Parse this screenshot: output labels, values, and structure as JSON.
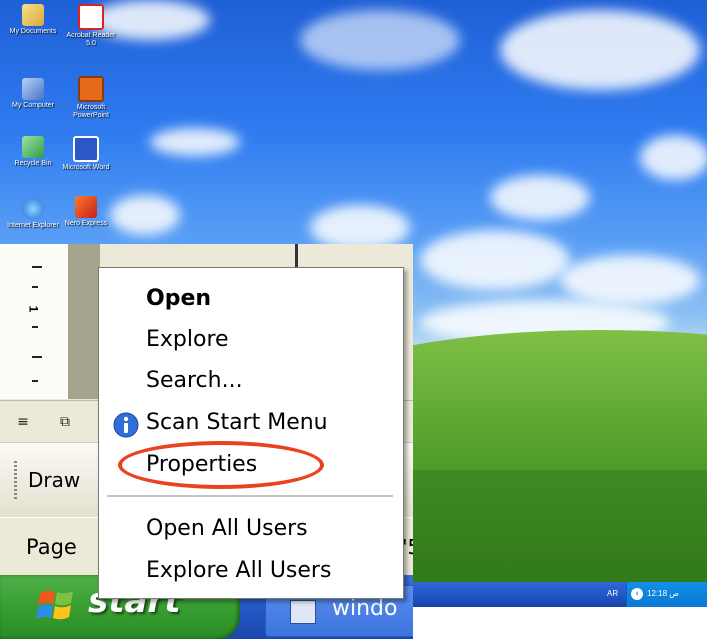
{
  "desktop": {
    "icons": [
      {
        "name": "my-documents-icon",
        "label": "My Documents"
      },
      {
        "name": "acrobat-reader-icon",
        "label": "Acrobat Reader 5.0"
      },
      {
        "name": "my-computer-icon",
        "label": "My Computer"
      },
      {
        "name": "powerpoint-icon",
        "label": "Microsoft PowerPoint"
      },
      {
        "name": "recycle-bin-icon",
        "label": "Recycle Bin"
      },
      {
        "name": "word-icon",
        "label": "Microsoft Word"
      },
      {
        "name": "internet-explorer-icon",
        "label": "Internet Explorer"
      },
      {
        "name": "nero-express-icon",
        "label": "Nero Express"
      }
    ],
    "tray": {
      "language": "AR",
      "clock": "12:18 ص"
    }
  },
  "word_window": {
    "ruler_number": "1",
    "draw_toolbar_label": "Draw",
    "status_page_label": "Page",
    "status_fragment": "'5"
  },
  "taskbar": {
    "start_label": "start",
    "task_label": "windo"
  },
  "context_menu": {
    "items": [
      {
        "label": "Open",
        "default": true
      },
      {
        "label": "Explore"
      },
      {
        "label": "Search..."
      },
      {
        "label": "Scan Start Menu"
      },
      {
        "label": "Properties"
      },
      {
        "label": "Open All Users"
      },
      {
        "label": "Explore All Users"
      }
    ]
  },
  "colors": {
    "highlight_ring": "#e8421f",
    "start_green": "#379f32",
    "taskbar_blue": "#2457c5"
  }
}
